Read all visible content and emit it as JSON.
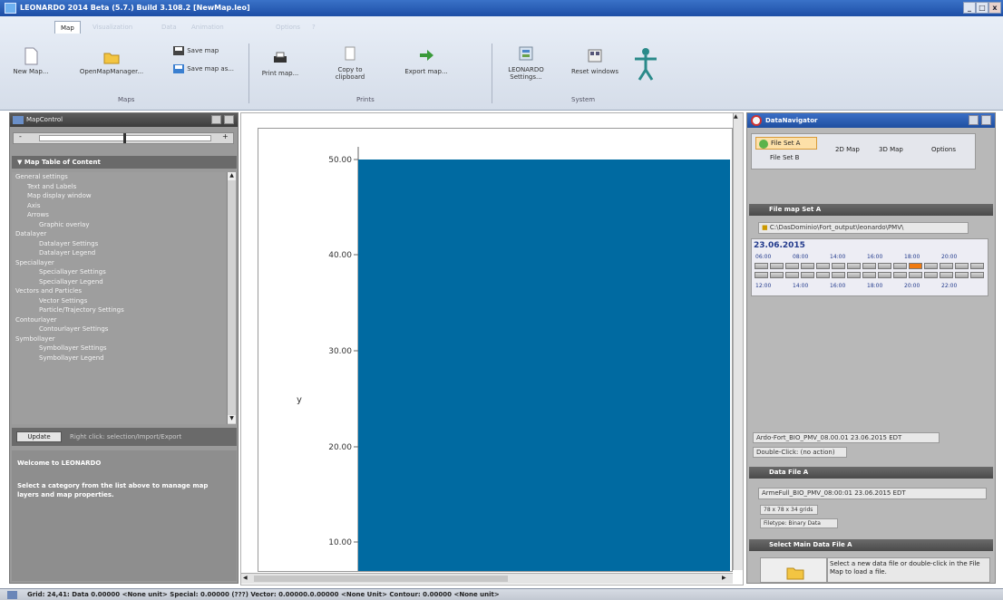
{
  "window": {
    "title": "LEONARDO 2014 Beta (5.7.) Build 3.108.2 [NewMap.leo]",
    "min": "_",
    "restore": "□",
    "close": "x"
  },
  "ribbon": {
    "tabs": [
      "Map",
      "Visualization",
      "Data",
      "Animation",
      "Options",
      "?"
    ],
    "buttons": {
      "new_map": "New Map...",
      "open_map_manager": "OpenMapManager...",
      "save_map": "Save map",
      "save_map_as": "Save map as...",
      "print_map": "Print map...",
      "copy_clipboard": "Copy to clipboard",
      "export_map": "Export map...",
      "leonardo_settings": "LEONARDO Settings...",
      "reset_windows": "Reset windows"
    },
    "groups": {
      "maps": "Maps",
      "prints": "Prints",
      "system": "System"
    }
  },
  "map_control": {
    "title": "MapControl",
    "toc_title": "Map Table of Content",
    "tree": [
      {
        "label": "General settings",
        "level": 0
      },
      {
        "label": "Text and Labels",
        "level": 1
      },
      {
        "label": "Map display window",
        "level": 1
      },
      {
        "label": "Axis",
        "level": 1
      },
      {
        "label": "Arrows",
        "level": 1
      },
      {
        "label": "Graphic overlay",
        "level": 2
      },
      {
        "label": "Datalayer",
        "level": 0
      },
      {
        "label": "Datalayer Settings",
        "level": 2
      },
      {
        "label": "Datalayer Legend",
        "level": 2
      },
      {
        "label": "Speciallayer",
        "level": 0
      },
      {
        "label": "Speciallayer Settings",
        "level": 2
      },
      {
        "label": "Speciallayer Legend",
        "level": 2
      },
      {
        "label": "Vectors and Particles",
        "level": 0
      },
      {
        "label": "Vector Settings",
        "level": 2
      },
      {
        "label": "Particle/Trajectory Settings",
        "level": 2
      },
      {
        "label": "Contourlayer",
        "level": 0
      },
      {
        "label": "Contourlayer Settings",
        "level": 2
      },
      {
        "label": "Symbollayer",
        "level": 0
      },
      {
        "label": "Symbollayer Settings",
        "level": 2
      },
      {
        "label": "Symbollayer Legend",
        "level": 2
      }
    ],
    "update_button": "Update",
    "right_click_hint": "Right click: selection/Import/Export",
    "welcome_title": "Welcome to LEONARDO",
    "welcome_text": "Select a category from the list above to manage map layers and map properties."
  },
  "plot": {
    "ylabel": "y",
    "ticks": [
      "50.00",
      "40.00",
      "30.00",
      "20.00",
      "10.00"
    ],
    "fill_color": "#006aa1"
  },
  "navigator": {
    "title": "DataNavigator",
    "tabs": {
      "file_set_a": "File Set A",
      "file_set_b": "File Set B",
      "two_d_map": "2D Map",
      "three_d_map": "3D Map",
      "options": "Options"
    },
    "file_map_title": "File map Set A",
    "path": "C:\\DasDominio\\Fort_output\\leonardo\\PMV\\",
    "date": "23.06.2015",
    "times_top": [
      "06:00",
      "08:00",
      "14:00",
      "16:00",
      "18:00",
      "20:00"
    ],
    "times_bottom": [
      "12:00",
      "14:00",
      "16:00",
      "18:00",
      "20:00",
      "22:00"
    ],
    "selected_file": "Ardo-Fort_BIO_PMV_08.00.01 23.06.2015 EDT",
    "double_click": "Double-Click: (no action)",
    "data_file_title": "Data File A",
    "data_file_name": "ArmeFull_BIO_PMV_08:00:01 23.06.2015 EDT",
    "grid_info": "78 x 78 x 34 grids",
    "file_type": "Filetype: Binary Data",
    "select_title": "Select Main Data File A",
    "select_hint": "Select a new data file or double-click in the File Map to load a file."
  },
  "status": {
    "text": "Grid: 24,41: Data 0.00000 <None unit> Special: 0.00000 (???) Vector: 0.00000.0.00000 <None Unit> Contour: 0.00000 <None unit>"
  }
}
